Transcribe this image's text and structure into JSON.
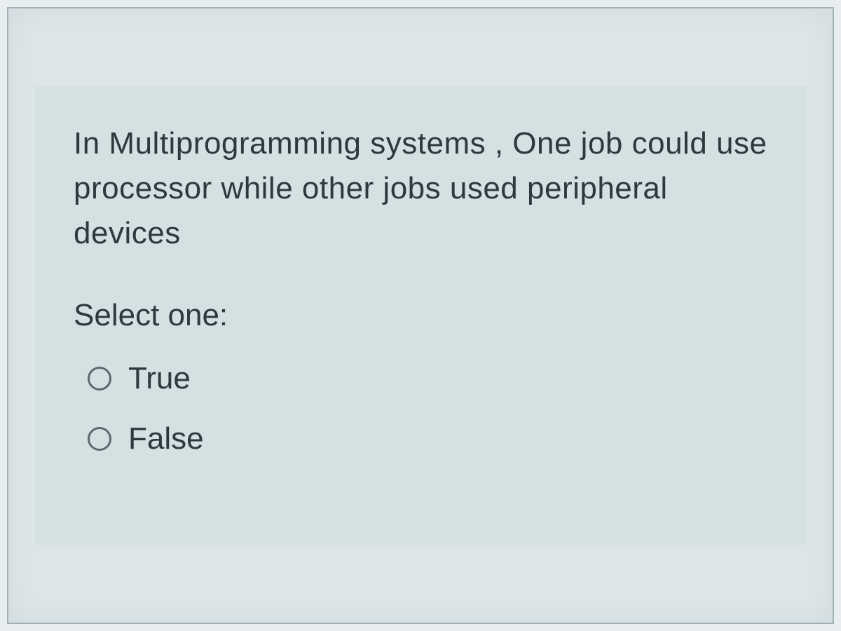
{
  "question": {
    "text": "In Multiprogramming systems , One job could use processor while other jobs used peripheral devices",
    "prompt": "Select one:",
    "options": [
      {
        "label": "True"
      },
      {
        "label": "False"
      }
    ]
  }
}
